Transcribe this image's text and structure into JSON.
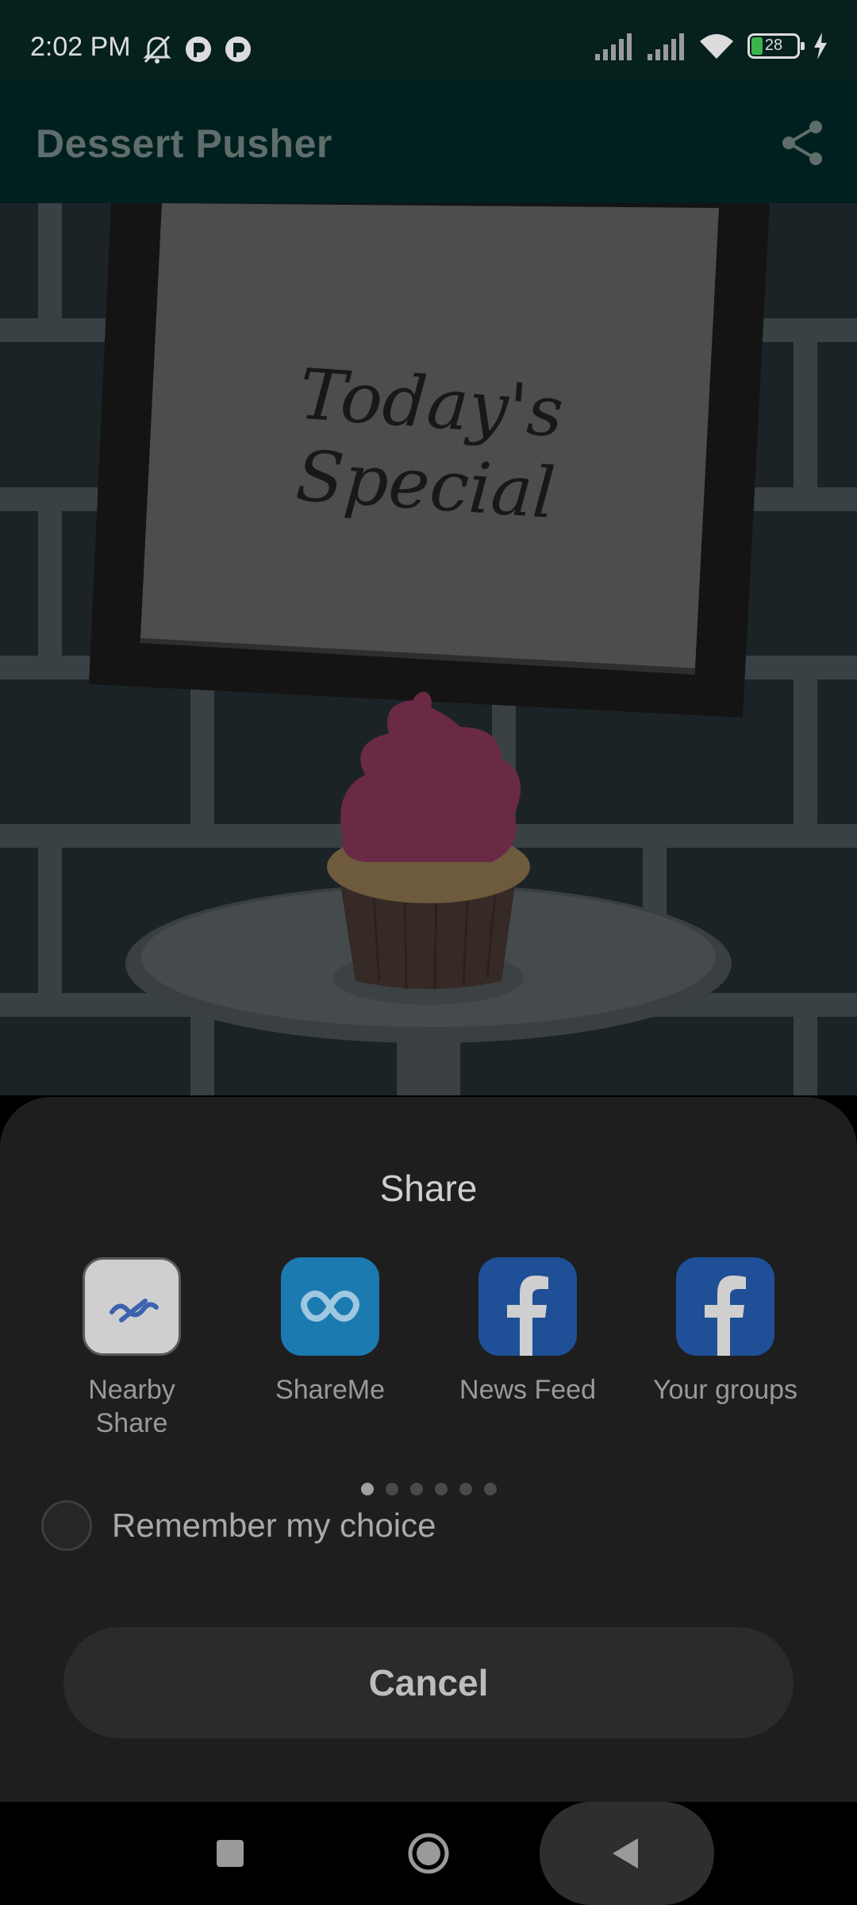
{
  "status_bar": {
    "time": "2:02 PM",
    "battery": "28",
    "icons_left": [
      "alarm-off-icon",
      "app-notification-icon",
      "app-notification-icon"
    ],
    "icons_right": [
      "signal-icon",
      "signal-icon",
      "wifi-icon",
      "battery-icon",
      "charging-icon"
    ]
  },
  "app_bar": {
    "title": "Dessert Pusher",
    "share_icon": "share-icon"
  },
  "scene": {
    "sign_text": "Today's Special"
  },
  "share_sheet": {
    "title": "Share",
    "apps": [
      {
        "label_line1": "Nearby",
        "label_line2": "Share",
        "icon": "nearby-share-icon"
      },
      {
        "label_line1": "ShareMe",
        "label_line2": "",
        "icon": "shareme-icon"
      },
      {
        "label_line1": "News Feed",
        "label_line2": "",
        "icon": "facebook-icon"
      },
      {
        "label_line1": "Your groups",
        "label_line2": "",
        "icon": "facebook-icon"
      }
    ],
    "page_count": 6,
    "current_page": 1,
    "remember_label": "Remember my choice",
    "remember_checked": false,
    "cancel_label": "Cancel"
  },
  "nav_bar": {
    "buttons": [
      "recents-icon",
      "home-icon",
      "back-icon"
    ]
  }
}
